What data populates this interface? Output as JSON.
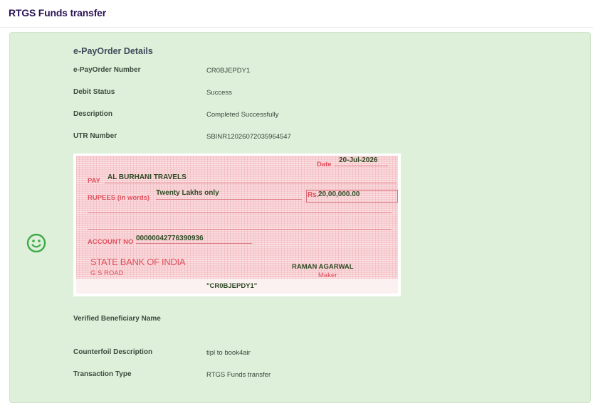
{
  "page": {
    "title": "RTGS  Funds transfer"
  },
  "details": {
    "heading": "e-PayOrder Details",
    "rows": [
      {
        "label": "e-PayOrder Number",
        "value": "CR0BJEPDY1"
      },
      {
        "label": "Debit Status",
        "value": "Success"
      },
      {
        "label": "Description",
        "value": "Completed Successfully"
      },
      {
        "label": "UTR Number",
        "value": "SBINR12026072035964547"
      }
    ],
    "rows_after": [
      {
        "label": "Verified Beneficiary Name",
        "value": ""
      },
      {
        "label": "Counterfoil Description",
        "value": "tipl to book4air"
      },
      {
        "label": "Transaction Type",
        "value": "RTGS Funds transfer"
      }
    ]
  },
  "cheque": {
    "date_label": "Date",
    "date_value": "20-Jul-2026",
    "pay_label": "PAY",
    "payee": "AL BURHANI TRAVELS",
    "rupees_label": "RUPEES (in words)",
    "amount_words": "Twenty Lakhs only",
    "rs_label": "Rs.",
    "amount": "20,00,000.00",
    "account_label": "ACCOUNT NO",
    "account_no": "00000042776390936",
    "bank_name": "STATE BANK OF INDIA",
    "branch": "G S ROAD",
    "signatory": "RAMAN AGARWAL",
    "signatory_role": "Maker",
    "order_ref": "\"CR0BJEPDY1\""
  },
  "icons": {
    "status": "smiley-icon",
    "status_color": "#3daa48"
  },
  "colors": {
    "panel_bg": "#dff0da",
    "title": "#2b1454",
    "cheque_red": "#e0505d"
  }
}
